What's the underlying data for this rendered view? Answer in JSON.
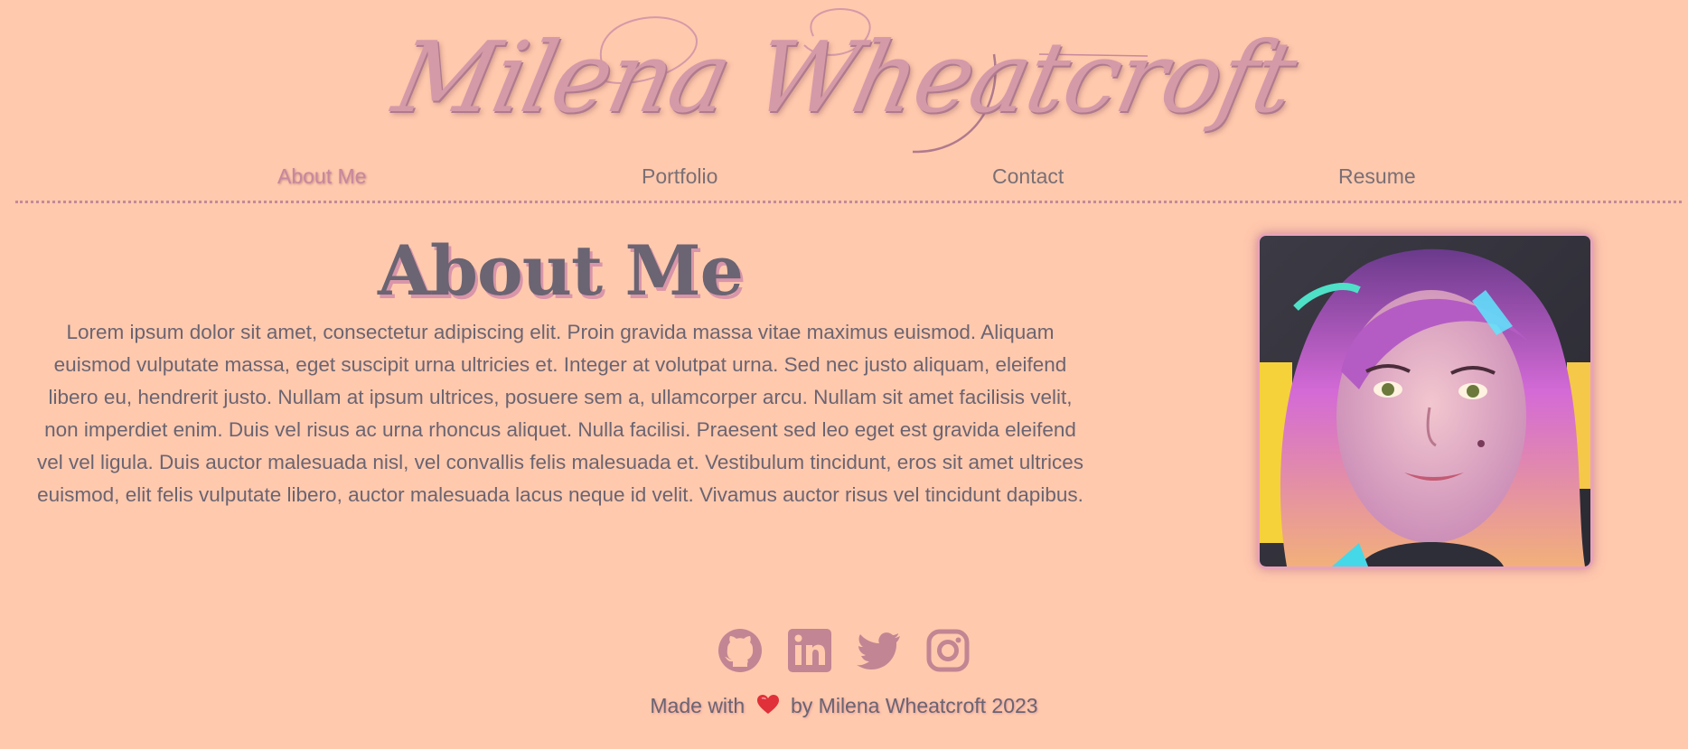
{
  "site": {
    "logo_text": "Milena Wheatcroft"
  },
  "nav": {
    "items": [
      {
        "label": "About Me",
        "active": true
      },
      {
        "label": "Portfolio",
        "active": false
      },
      {
        "label": "Contact",
        "active": false
      },
      {
        "label": "Resume",
        "active": false
      }
    ]
  },
  "about": {
    "title": "About Me",
    "paragraph_lines": [
      "Lorem ipsum dolor sit amet, consectetur adipiscing elit. Proin gravida massa vitae maximus euismod. Aliquam",
      "euismod vulputate massa, eget suscipit urna ultricies et. Integer at volutpat urna. Sed nec justo aliquam, eleifend",
      "libero eu, hendrerit justo. Nullam at ipsum ultrices, posuere sem a, ullamcorper arcu. Nullam sit amet facilisis velit,",
      "non imperdiet enim. Duis vel risus ac urna rhoncus aliquet. Nulla facilisi. Praesent sed leo eget est gravida eleifend",
      "vel vel ligula. Duis auctor malesuada nisl, vel convallis felis malesuada et. Vestibulum tincidunt, eros sit amet ultrices",
      "euismod, elit felis vulputate libero, auctor malesuada lacus neque id velit. Vivamus auctor risus vel tincidunt dapibus."
    ]
  },
  "social": {
    "icons": [
      "github-icon",
      "linkedin-icon",
      "twitter-icon",
      "instagram-icon"
    ]
  },
  "footer": {
    "made_with": "Made with",
    "by_text": "by Milena Wheatcroft 2023"
  },
  "colors": {
    "background": "#ffc9ad",
    "accent": "#c8879e",
    "text": "#6b6472",
    "heart": "#e0303a"
  }
}
